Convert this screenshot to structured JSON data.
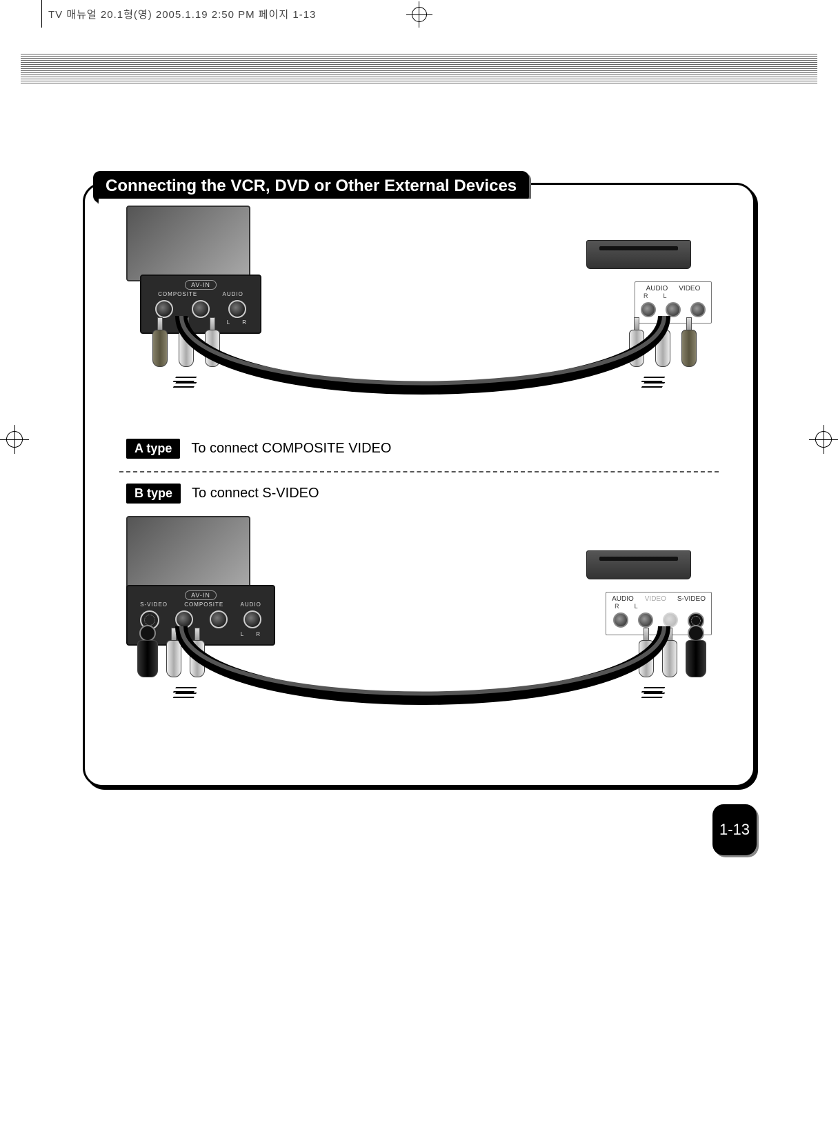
{
  "doc_header": "TV 매뉴얼 20.1형(영)  2005.1.19 2:50 PM  페이지 1-13",
  "section_title": "Connecting the VCR, DVD or Other External Devices",
  "type_a": {
    "badge": "A type",
    "desc": "To connect COMPOSITE VIDEO"
  },
  "type_b": {
    "badge": "B type",
    "desc": "To connect S-VIDEO"
  },
  "av_panel": {
    "title": "AV-IN",
    "labels": [
      "COMPOSITE",
      "AUDIO"
    ],
    "lr": [
      "L",
      "R"
    ],
    "labels_svideo": [
      "S-VIDEO",
      "COMPOSITE",
      "AUDIO"
    ]
  },
  "vcr_panel_a": {
    "cols": [
      "AUDIO",
      "VIDEO"
    ],
    "sub": [
      "R",
      "L"
    ]
  },
  "vcr_panel_b": {
    "cols": [
      "AUDIO",
      "VIDEO",
      "S-VIDEO"
    ],
    "sub": [
      "R",
      "L"
    ]
  },
  "page_number": "1-13"
}
